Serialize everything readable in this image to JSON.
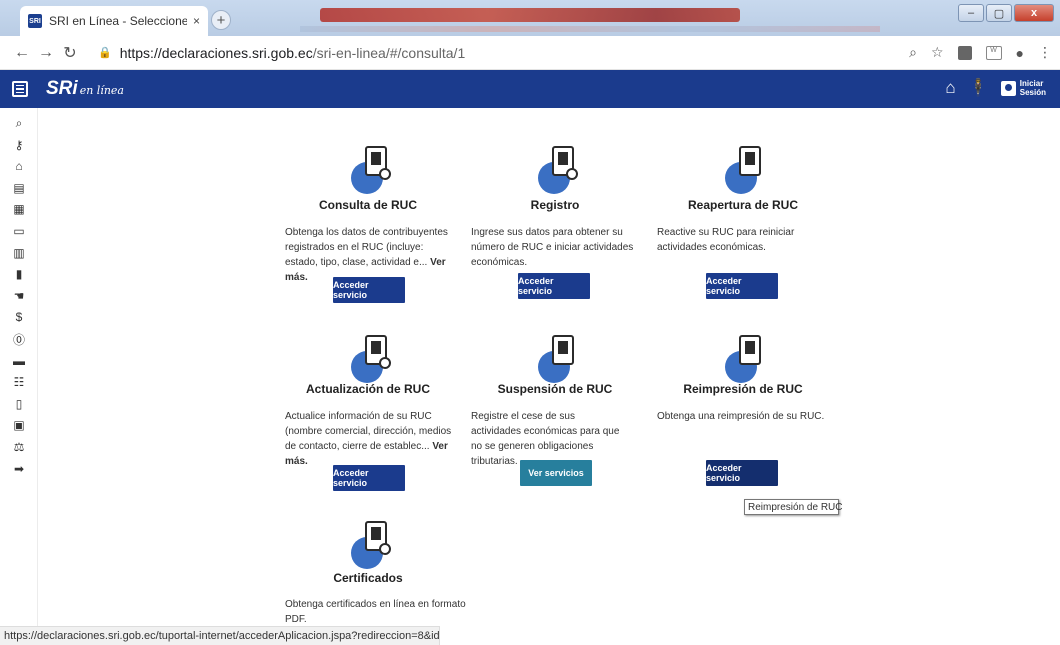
{
  "browser": {
    "tab_title": "SRI en Línea - Seleccione su cons",
    "tab_close": "×",
    "new_tab": "+",
    "url_host": "https://declaraciones.sri.gob.ec",
    "url_path": "/sri-en-linea/#/consulta/1",
    "status_url": "https://declaraciones.sri.gob.ec/tuportal-internet/accederAplicacion.jspa?redireccion=8&idGrupo=1"
  },
  "header": {
    "logo": "SRi",
    "logo_sub": "en línea",
    "login_line1": "Iniciar",
    "login_line2": "Sesión"
  },
  "sidebar_icons": [
    "search-icon",
    "key-icon",
    "bank-icon",
    "building-icon",
    "office-icon",
    "inbox-icon",
    "document-icon",
    "file-icon",
    "hand-icon",
    "dollar-icon",
    "coin-icon",
    "money-icon",
    "receipt-icon",
    "paper-icon",
    "car-icon",
    "scale-icon",
    "logout-icon"
  ],
  "cards": [
    {
      "title": "Consulta de RUC",
      "desc": "Obtenga los datos de contribuyentes registrados en el RUC (incluye: estado, tipo, clase, actividad e...",
      "more": "Ver más.",
      "button": "Acceder servicio"
    },
    {
      "title": "Registro",
      "desc": "Ingrese sus datos para obtener su número de RUC e iniciar actividades económicas.",
      "button": "Acceder servicio"
    },
    {
      "title": "Reapertura de RUC",
      "desc": "Reactive su RUC para reiniciar actividades económicas.",
      "button": "Acceder servicio"
    },
    {
      "title": "Actualización de RUC",
      "desc": "Actualice información de su RUC (nombre comercial, dirección, medios de contacto, cierre de establec...",
      "more": "Ver más.",
      "button": "Acceder servicio"
    },
    {
      "title": "Suspensión de RUC",
      "desc": "Registre el cese de sus actividades económicas para que no se generen obligaciones tributarias.",
      "button": "Ver servicios"
    },
    {
      "title": "Reimpresión de RUC",
      "desc": "Obtenga una reimpresión de su RUC.",
      "button": "Acceder servicio"
    },
    {
      "title": "Certificados",
      "desc": "Obtenga certificados en línea en formato PDF."
    }
  ],
  "tooltip": "Reimpresión de RUC"
}
